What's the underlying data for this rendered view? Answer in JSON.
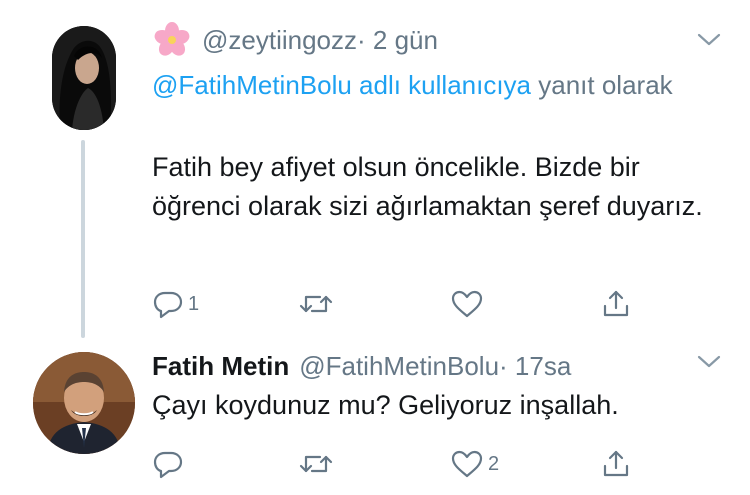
{
  "tweets": [
    {
      "handle": "@zeytiingozz",
      "time": " · 2 gün",
      "reply_context": {
        "mention": "@FatihMetinBolu adlı kullanıcıya",
        "suffix": " yanıt olarak"
      },
      "text": "Fatih bey afiyet olsun öncelikle. Bizde bir öğrenci olarak sizi ağırlamaktan şeref duyarız.",
      "reply_count": "1",
      "retweet_count": "",
      "like_count": ""
    },
    {
      "name": "Fatih Metin",
      "handle": "@FatihMetinBolu",
      "time": " · 17sa",
      "text": "Çayı koydunuz mu? Geliyoruz inşallah.",
      "reply_count": "",
      "retweet_count": "",
      "like_count": "2"
    }
  ],
  "icons": {
    "reply": "reply-icon",
    "retweet": "retweet-icon",
    "like": "heart-icon",
    "share": "share-icon",
    "caret": "chevron-down-icon",
    "flower": "cherry-blossom-icon"
  },
  "colors": {
    "link": "#1da1f2",
    "secondary_text": "#657786",
    "primary_text": "#14171a",
    "thread_line": "#ccd6dd"
  }
}
